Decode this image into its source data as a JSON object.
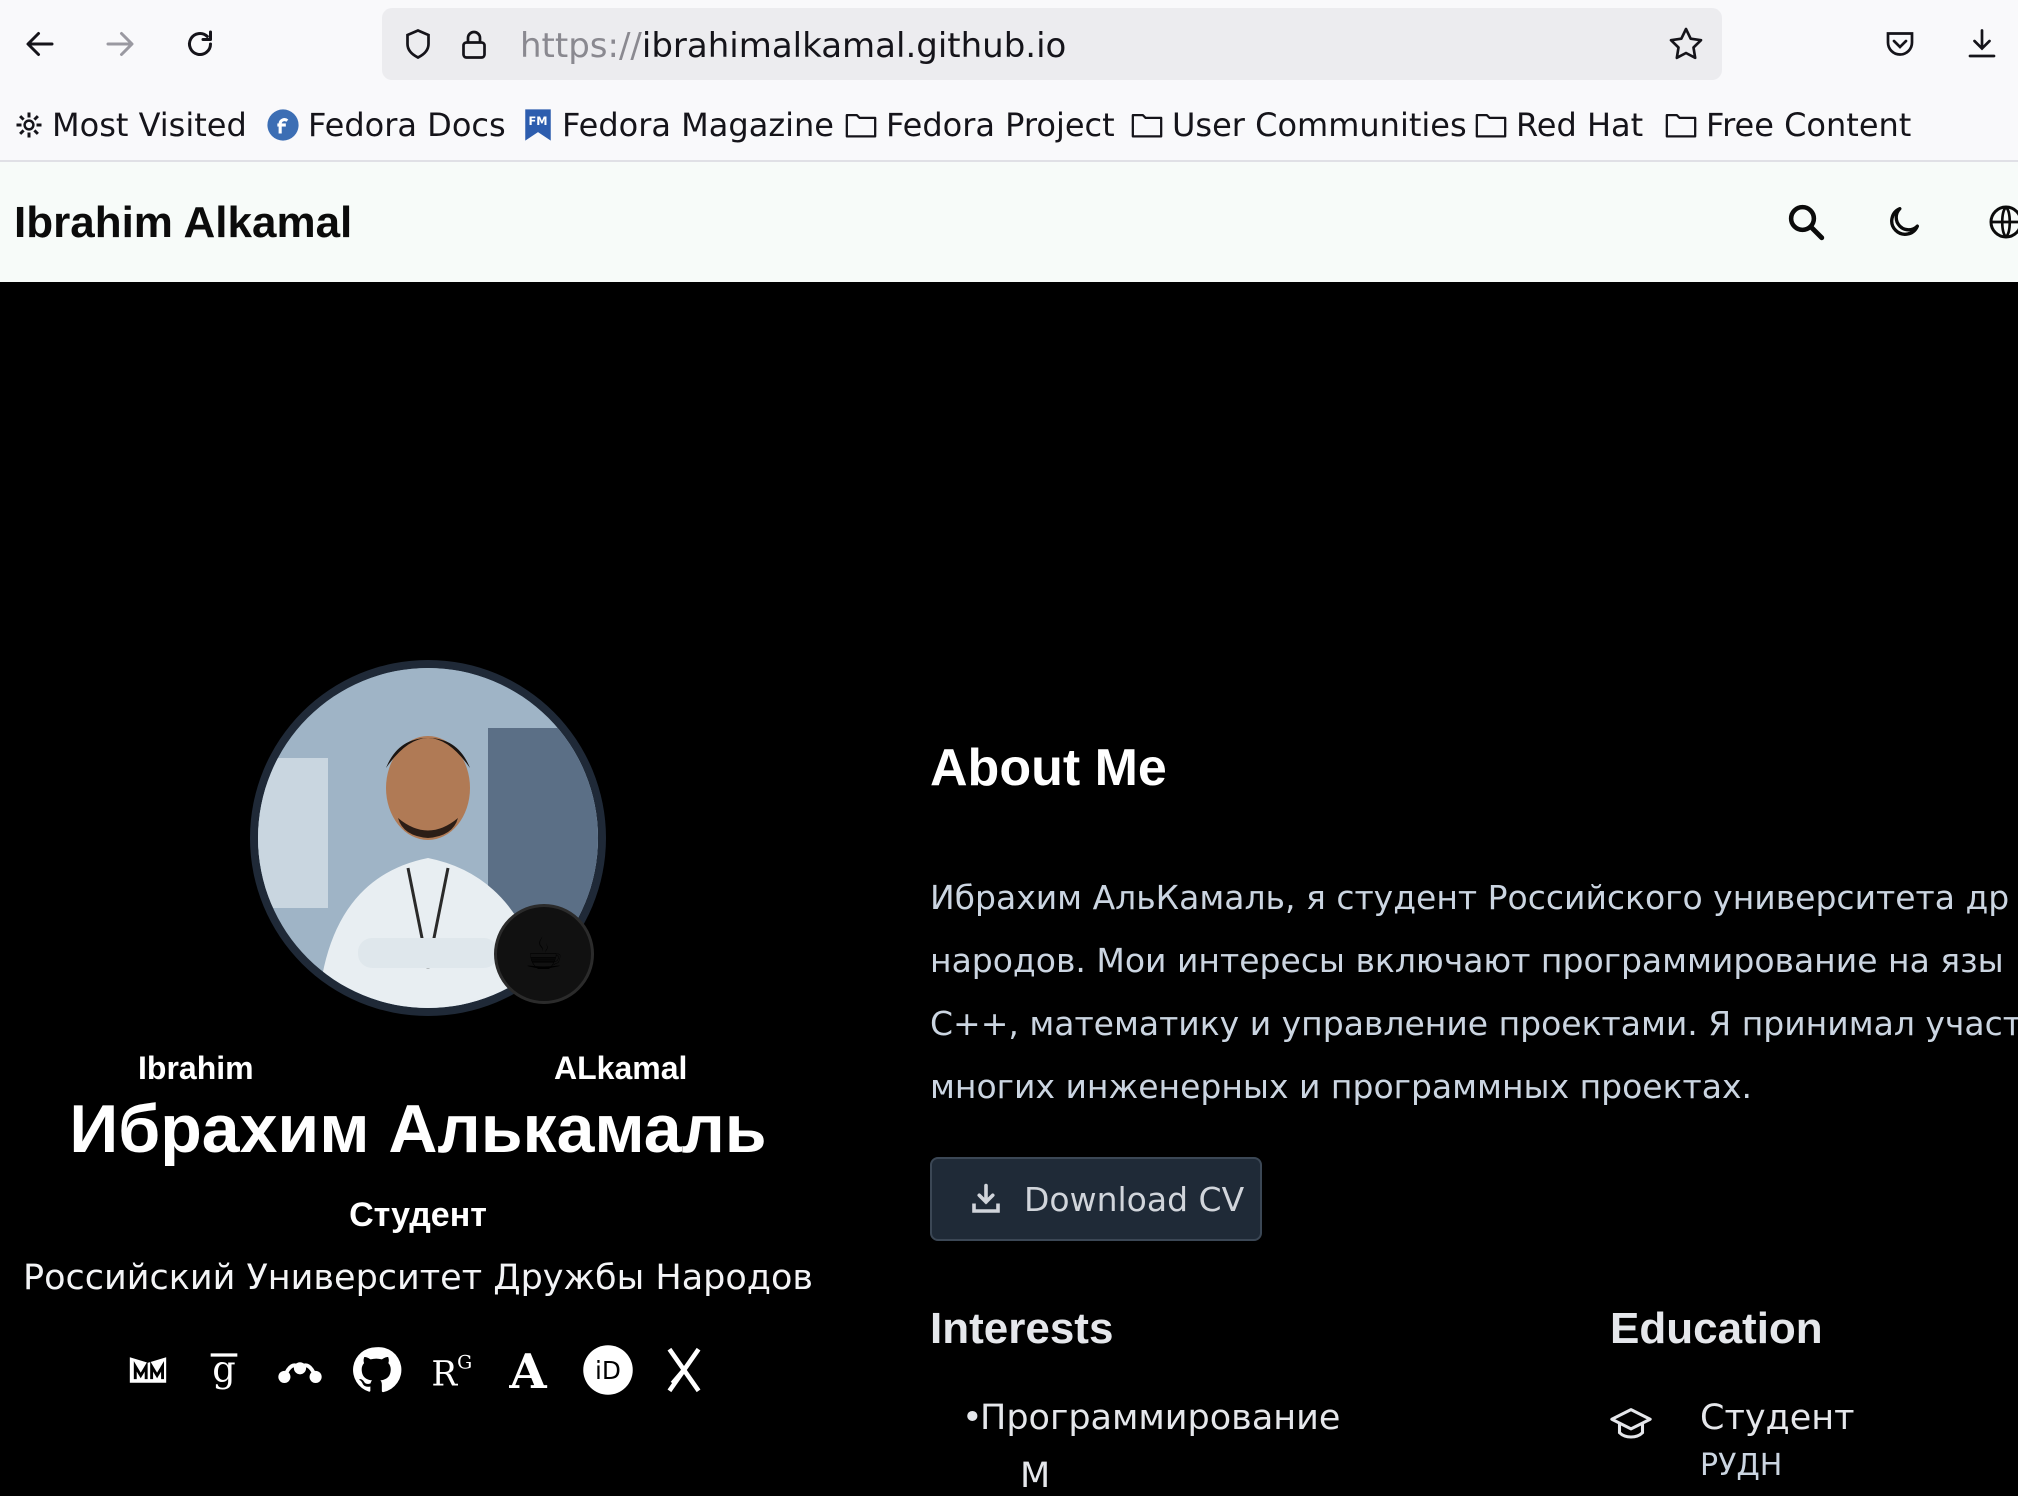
{
  "browser": {
    "url_protocol": "https://",
    "url_domain": "ibrahimalkamal.github.io",
    "bookmarks": [
      "Most Visited",
      "Fedora Docs",
      "Fedora Magazine",
      "Fedora Project",
      "User Communities",
      "Red Hat",
      "Free Content"
    ]
  },
  "site": {
    "title": "Ibrahim Alkamal"
  },
  "profile": {
    "first_name": "Ibrahim",
    "last_name": "ALkamal",
    "full_name_ru": "Ибрахим Алькамаль",
    "role": "Студент",
    "organization": "Российский Университет Дружбы Народов",
    "badge_emoji": "☕",
    "socials": [
      "email-icon",
      "google-scholar-icon",
      "mendeley-icon",
      "github-icon",
      "researchgate-icon",
      "academia-icon",
      "orcid-icon",
      "x-twitter-icon"
    ]
  },
  "about": {
    "title": "About Me",
    "bio_lines": [
      "Ибрахим АльКамаль, я студент Российского университета др",
      "народов. Мои интересы включают программирование на язы",
      "C++, математику и управление проектами. Я принимал участ",
      "многих инженерных и программных проектах."
    ],
    "download_cv": "Download CV"
  },
  "interests": {
    "title": "Interests",
    "items": [
      "Программирование",
      "М"
    ]
  },
  "education": {
    "title": "Education",
    "items": [
      {
        "degree": "Студент",
        "school": "РУДН"
      }
    ]
  }
}
